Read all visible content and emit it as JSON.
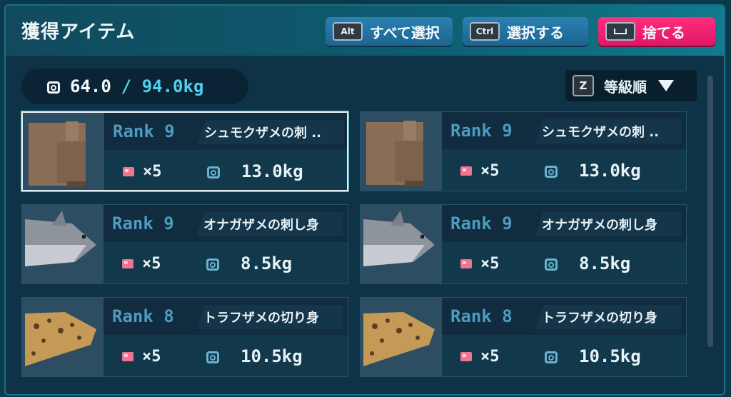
{
  "header": {
    "title": "獲得アイテム",
    "buttons": [
      {
        "key": "Alt",
        "label": "すべて選択"
      },
      {
        "key": "Ctrl",
        "label": "選択する"
      },
      {
        "key": "",
        "label": "捨てる"
      }
    ]
  },
  "weight": {
    "current": "64.0",
    "max": "/ 94.0kg"
  },
  "sort": {
    "key": "Z",
    "label": "等級順"
  },
  "colors": {
    "accent": "#4fd0ea",
    "discard": "#ff2f7d",
    "rank": "#4d9bc0"
  },
  "items": [
    {
      "rank": "Rank 9",
      "name": "シュモクザメの刺 ..",
      "qty": "×5",
      "weight": "13.0kg",
      "icon": "hammerhead-shark-icon",
      "selected": true
    },
    {
      "rank": "Rank 9",
      "name": "シュモクザメの刺 ..",
      "qty": "×5",
      "weight": "13.0kg",
      "icon": "hammerhead-shark-icon",
      "selected": false
    },
    {
      "rank": "Rank 9",
      "name": "オナガザメの刺し身",
      "qty": "×5",
      "weight": "8.5kg",
      "icon": "thresher-shark-icon",
      "selected": false
    },
    {
      "rank": "Rank 9",
      "name": "オナガザメの刺し身",
      "qty": "×5",
      "weight": "8.5kg",
      "icon": "thresher-shark-icon",
      "selected": false
    },
    {
      "rank": "Rank 8",
      "name": "トラフザメの切り身",
      "qty": "×5",
      "weight": "10.5kg",
      "icon": "leopard-shark-icon",
      "selected": false
    },
    {
      "rank": "Rank 8",
      "name": "トラフザメの切り身",
      "qty": "×5",
      "weight": "10.5kg",
      "icon": "leopard-shark-icon",
      "selected": false
    }
  ]
}
